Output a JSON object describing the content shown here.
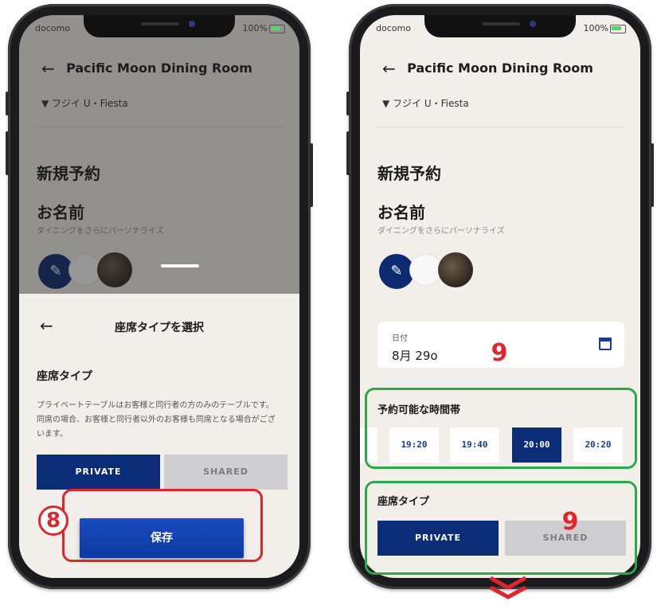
{
  "status": {
    "carrier": "docomo",
    "battery": "100%"
  },
  "appbar": {
    "title": "Pacific Moon Dining Room",
    "back_icon": "arrow-left-icon"
  },
  "faded_row": "フジイ U・Fiesta",
  "new_reservation": "新規予約",
  "name_heading": "お名前",
  "name_sub": "ダイニングをさらにパーソナライズ",
  "sheet": {
    "title": "座席タイプを選択",
    "section_heading": "座席タイプ",
    "description": "プライベートテーブルはお客様と同行者の方のみのテーブルです。同席の場合、お客様と同行者以外のお客様も同席となる場合がございます。",
    "private_label": "PRIVATE",
    "shared_label": "SHARED",
    "save_label": "保存"
  },
  "right": {
    "date_label": "日付",
    "date_value": "8月 29o",
    "time_heading": "予約可能な時間帯",
    "times": [
      "19:20",
      "19:40",
      "20:00",
      "20:20"
    ],
    "selected_time": "20:00",
    "seat_heading": "座席タイプ",
    "private_label": "PRIVATE",
    "shared_label": "SHARED"
  },
  "annotations": {
    "left_step": "8",
    "right_step_1": "9",
    "right_step_2": "9"
  },
  "colors": {
    "primary": "#0b2d78",
    "highlight_red": "#e0262b",
    "highlight_green": "#2aa84a"
  }
}
